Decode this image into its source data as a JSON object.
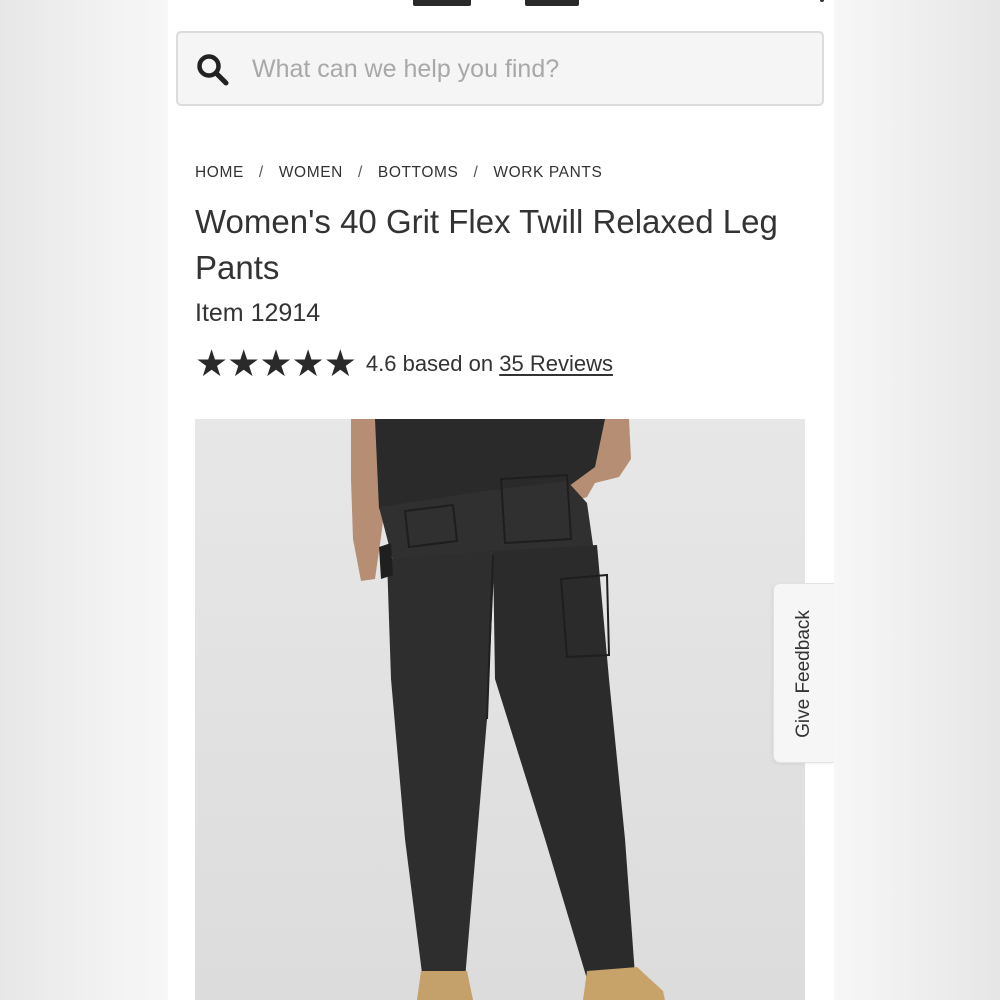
{
  "search": {
    "placeholder": "What can we help you find?",
    "icon": "search-icon"
  },
  "breadcrumb": [
    "HOME",
    "WOMEN",
    "BOTTOMS",
    "WORK PANTS"
  ],
  "breadcrumb_separator": "/",
  "product": {
    "title": "Women's 40 Grit Flex Twill Relaxed Leg Pants",
    "item_label": "Item",
    "item_number": "12914",
    "rating_value": "4.6",
    "rating_connector": "based on",
    "reviews_link": "35 Reviews",
    "stars_filled": 5,
    "image_alt": "black relaxed leg work pants"
  },
  "feedback": {
    "label": "Give Feedback"
  },
  "logo": {
    "text": "CO"
  },
  "colors": {
    "text": "#333333",
    "stars": "#2a2a2a",
    "pants": "#2b2b2b",
    "background_photo": "#e4e4e4"
  }
}
